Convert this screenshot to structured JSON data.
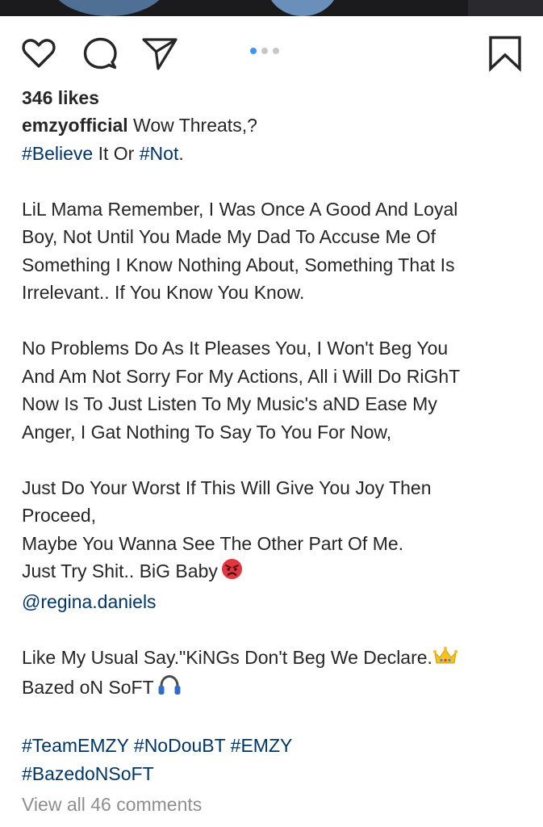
{
  "post": {
    "pager": {
      "count": 3,
      "active": 0
    },
    "likes": "346 likes",
    "username": "emzyofficial",
    "caption": {
      "l1": "Wow Threats,?",
      "l2_tag1": "#Believe",
      "l2_mid": "It Or",
      "l2_tag2": "#Not",
      "l2_end": ".",
      "p1": [
        "LiL Mama Remember, I Was Once A Good And Loyal",
        "Boy, Not Until You Made My Dad To Accuse Me Of",
        "Something I Know Nothing About, Something That Is",
        "Irrelevant.. If You Know You Know."
      ],
      "p2": [
        "No Problems Do As It Pleases You, I Won't Beg You",
        "And Am Not Sorry For My Actions, All i Will Do RiGhT",
        "Now Is To Just Listen To My Music's aND Ease My",
        "Anger, I Gat Nothing To Say To You For Now,"
      ],
      "p3": [
        "Just Do Your Worst If This Will Give You Joy Then",
        "Proceed,",
        "Maybe You Wanna See The Other Part Of Me."
      ],
      "p3_last": "Just Try Shit.. BiG Baby",
      "mention": "@regina.daniels",
      "p4_l1": "Like My Usual Say.\"KiNGs Don't Beg We Declare.",
      "p4_l2": "Bazed oN SoFT",
      "tags_l1": [
        "#TeamEMZY",
        "#NoDouBT",
        "#EMZY"
      ],
      "tags_l2": "#BazedoNSoFT"
    },
    "comments_link": "View all 46 comments"
  },
  "icons": {
    "like": "heart-icon",
    "comment": "comment-bubble-icon",
    "share": "paper-plane-icon",
    "save": "bookmark-icon",
    "emoji_angry": "angry-face-emoji",
    "emoji_crown": "crown-emoji",
    "emoji_headphones": "headphones-emoji"
  },
  "colors": {
    "text": "#262626",
    "hashtag": "#003569",
    "muted": "#8e8e8e",
    "pager_active": "#3897f0",
    "pager_inactive": "#c7c7c7"
  }
}
